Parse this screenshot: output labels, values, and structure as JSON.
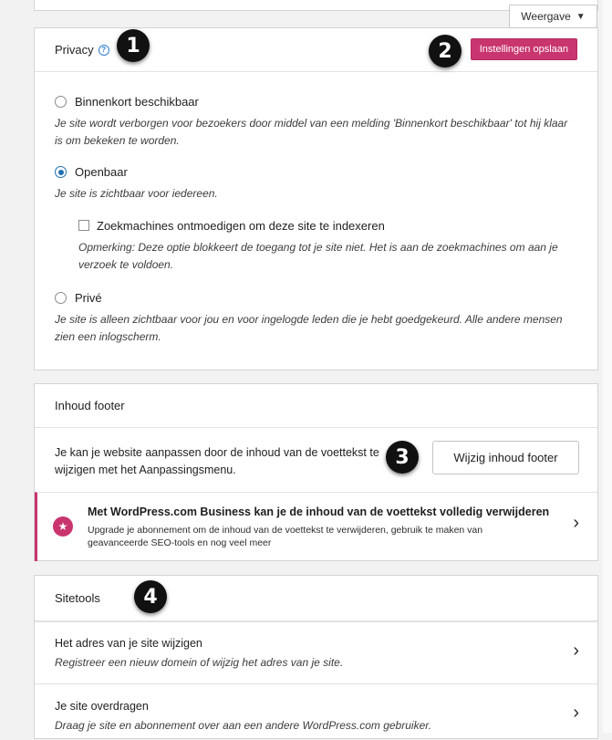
{
  "view_button": {
    "label": "Weergave",
    "icon": "caret-down-icon"
  },
  "privacy": {
    "title": "Privacy",
    "help_icon": "?",
    "save_button": "Instellingen opslaan",
    "options": [
      {
        "label": "Binnenkort beschikbaar",
        "description": "Je site wordt verborgen voor bezoekers door middel van een melding 'Binnenkort beschikbaar' tot hij klaar is om bekeken te worden.",
        "checked": false
      },
      {
        "label": "Openbaar",
        "description": "Je site is zichtbaar voor iedereen.",
        "checked": true
      },
      {
        "label": "Privé",
        "description": "Je site is alleen zichtbaar voor jou en voor ingelogde leden die je hebt goedgekeurd. Alle andere mensen zien een inlogscherm.",
        "checked": false
      }
    ],
    "search_engine": {
      "label": "Zoekmachines ontmoedigen om deze site te indexeren",
      "note": "Opmerking: Deze optie blokkeert de toegang tot je site niet. Het is aan de zoekmachines om aan je verzoek te voldoen.",
      "checked": false
    }
  },
  "footer": {
    "title": "Inhoud footer",
    "text": "Je kan je website aanpassen door de inhoud van de voettekst te wijzigen met het Aanpassingsmenu.",
    "button": "Wijzig inhoud footer",
    "upsell_title": "Met WordPress.com Business kan je de inhoud van de voettekst volledig verwijderen",
    "upsell_desc": "Upgrade je abonnement om de inhoud van de voettekst te verwijderen, gebruik te maken van geavanceerde SEO-tools en nog veel meer"
  },
  "sitetools": {
    "title": "Sitetools",
    "items": [
      {
        "title": "Het adres van je site wijzigen",
        "description": "Registreer een nieuw domein of wijzig het adres van je site."
      },
      {
        "title": "Je site overdragen",
        "description": "Draag je site en abonnement over aan een andere WordPress.com gebruiker."
      }
    ]
  },
  "badges": [
    "1",
    "2",
    "3",
    "4"
  ],
  "colors": {
    "accent": "#c9356e",
    "radio": "#2271b1",
    "badge": "#111111"
  }
}
